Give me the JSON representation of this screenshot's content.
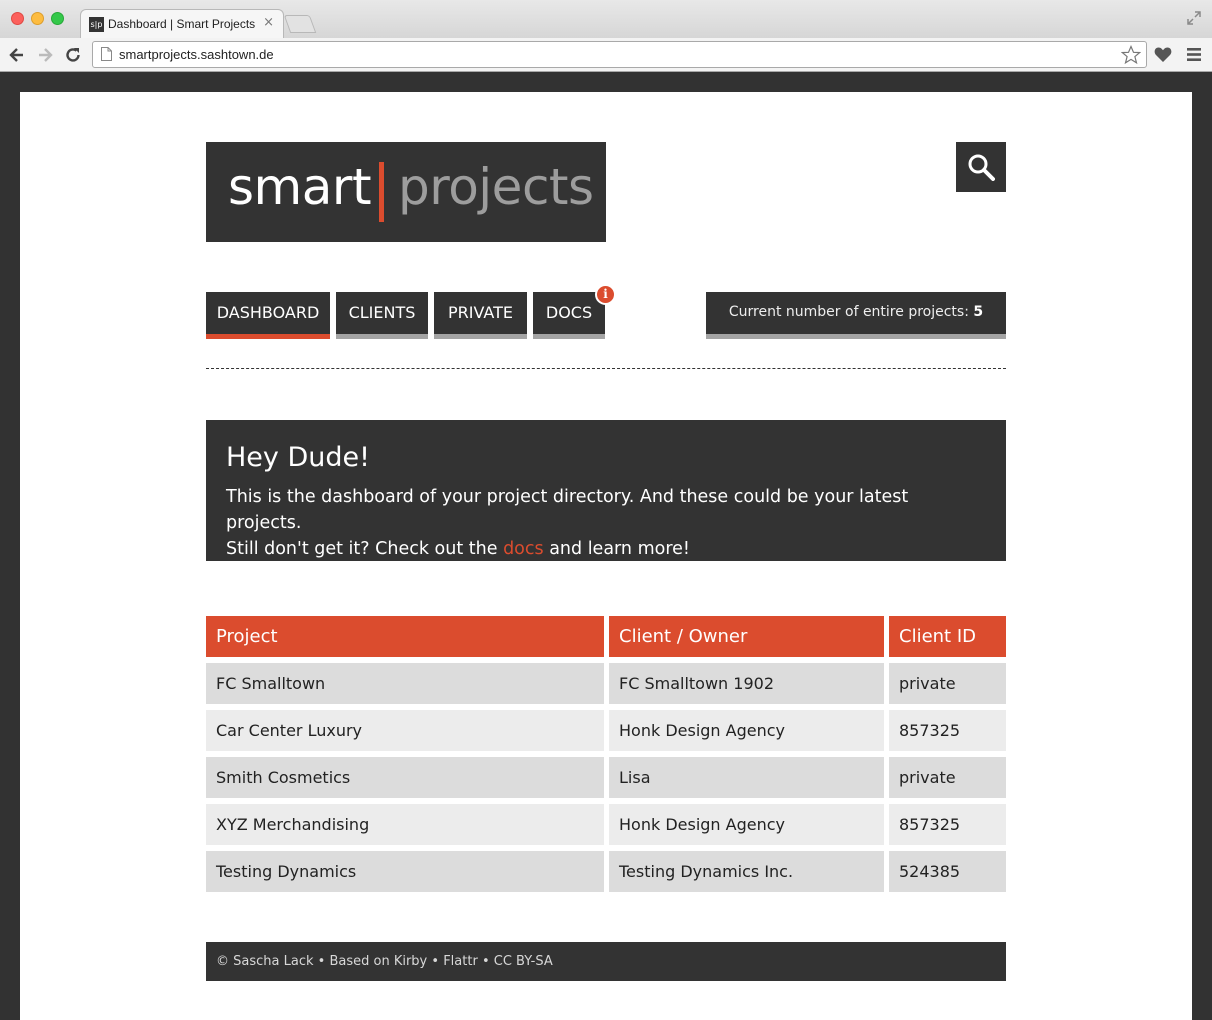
{
  "browser": {
    "tab_title": "Dashboard | Smart Projects",
    "favicon_text": "s|p",
    "tab_close": "×",
    "url": "smartprojects.sashtown.de"
  },
  "logo": {
    "left": "smart",
    "right": "projects"
  },
  "nav": {
    "items": [
      {
        "label": "DASHBOARD",
        "active": true
      },
      {
        "label": "CLIENTS",
        "active": false
      },
      {
        "label": "PRIVATE",
        "active": false
      },
      {
        "label": "DOCS",
        "active": false
      }
    ],
    "docs_badge": "i"
  },
  "counter": {
    "label": "Current number of entire projects:",
    "value": "5"
  },
  "welcome": {
    "title": "Hey Dude!",
    "line1": "This is the dashboard of your project directory. And these could be your latest projects.",
    "line2_before": "Still don't get it? Check out the",
    "link": "docs",
    "line2_after": "and learn more!"
  },
  "table": {
    "headers": [
      "Project",
      "Client / Owner",
      "Client ID"
    ],
    "rows": [
      [
        "FC Smalltown",
        "FC Smalltown 1902",
        "private"
      ],
      [
        "Car Center Luxury",
        "Honk Design Agency",
        "857325"
      ],
      [
        "Smith Cosmetics",
        "Lisa",
        "private"
      ],
      [
        "XYZ Merchandising",
        "Honk Design Agency",
        "857325"
      ],
      [
        "Testing Dynamics",
        "Testing Dynamics Inc.",
        "524385"
      ]
    ]
  },
  "footer": {
    "copyright": "© Sascha Lack",
    "sep": "•",
    "based_on": "Based on Kirby",
    "flattr": "Flattr",
    "license": "CC BY-SA"
  },
  "colors": {
    "accent": "#db4c2e",
    "dark": "#333333",
    "row_odd": "#dcdcdc",
    "row_even": "#ececec"
  }
}
